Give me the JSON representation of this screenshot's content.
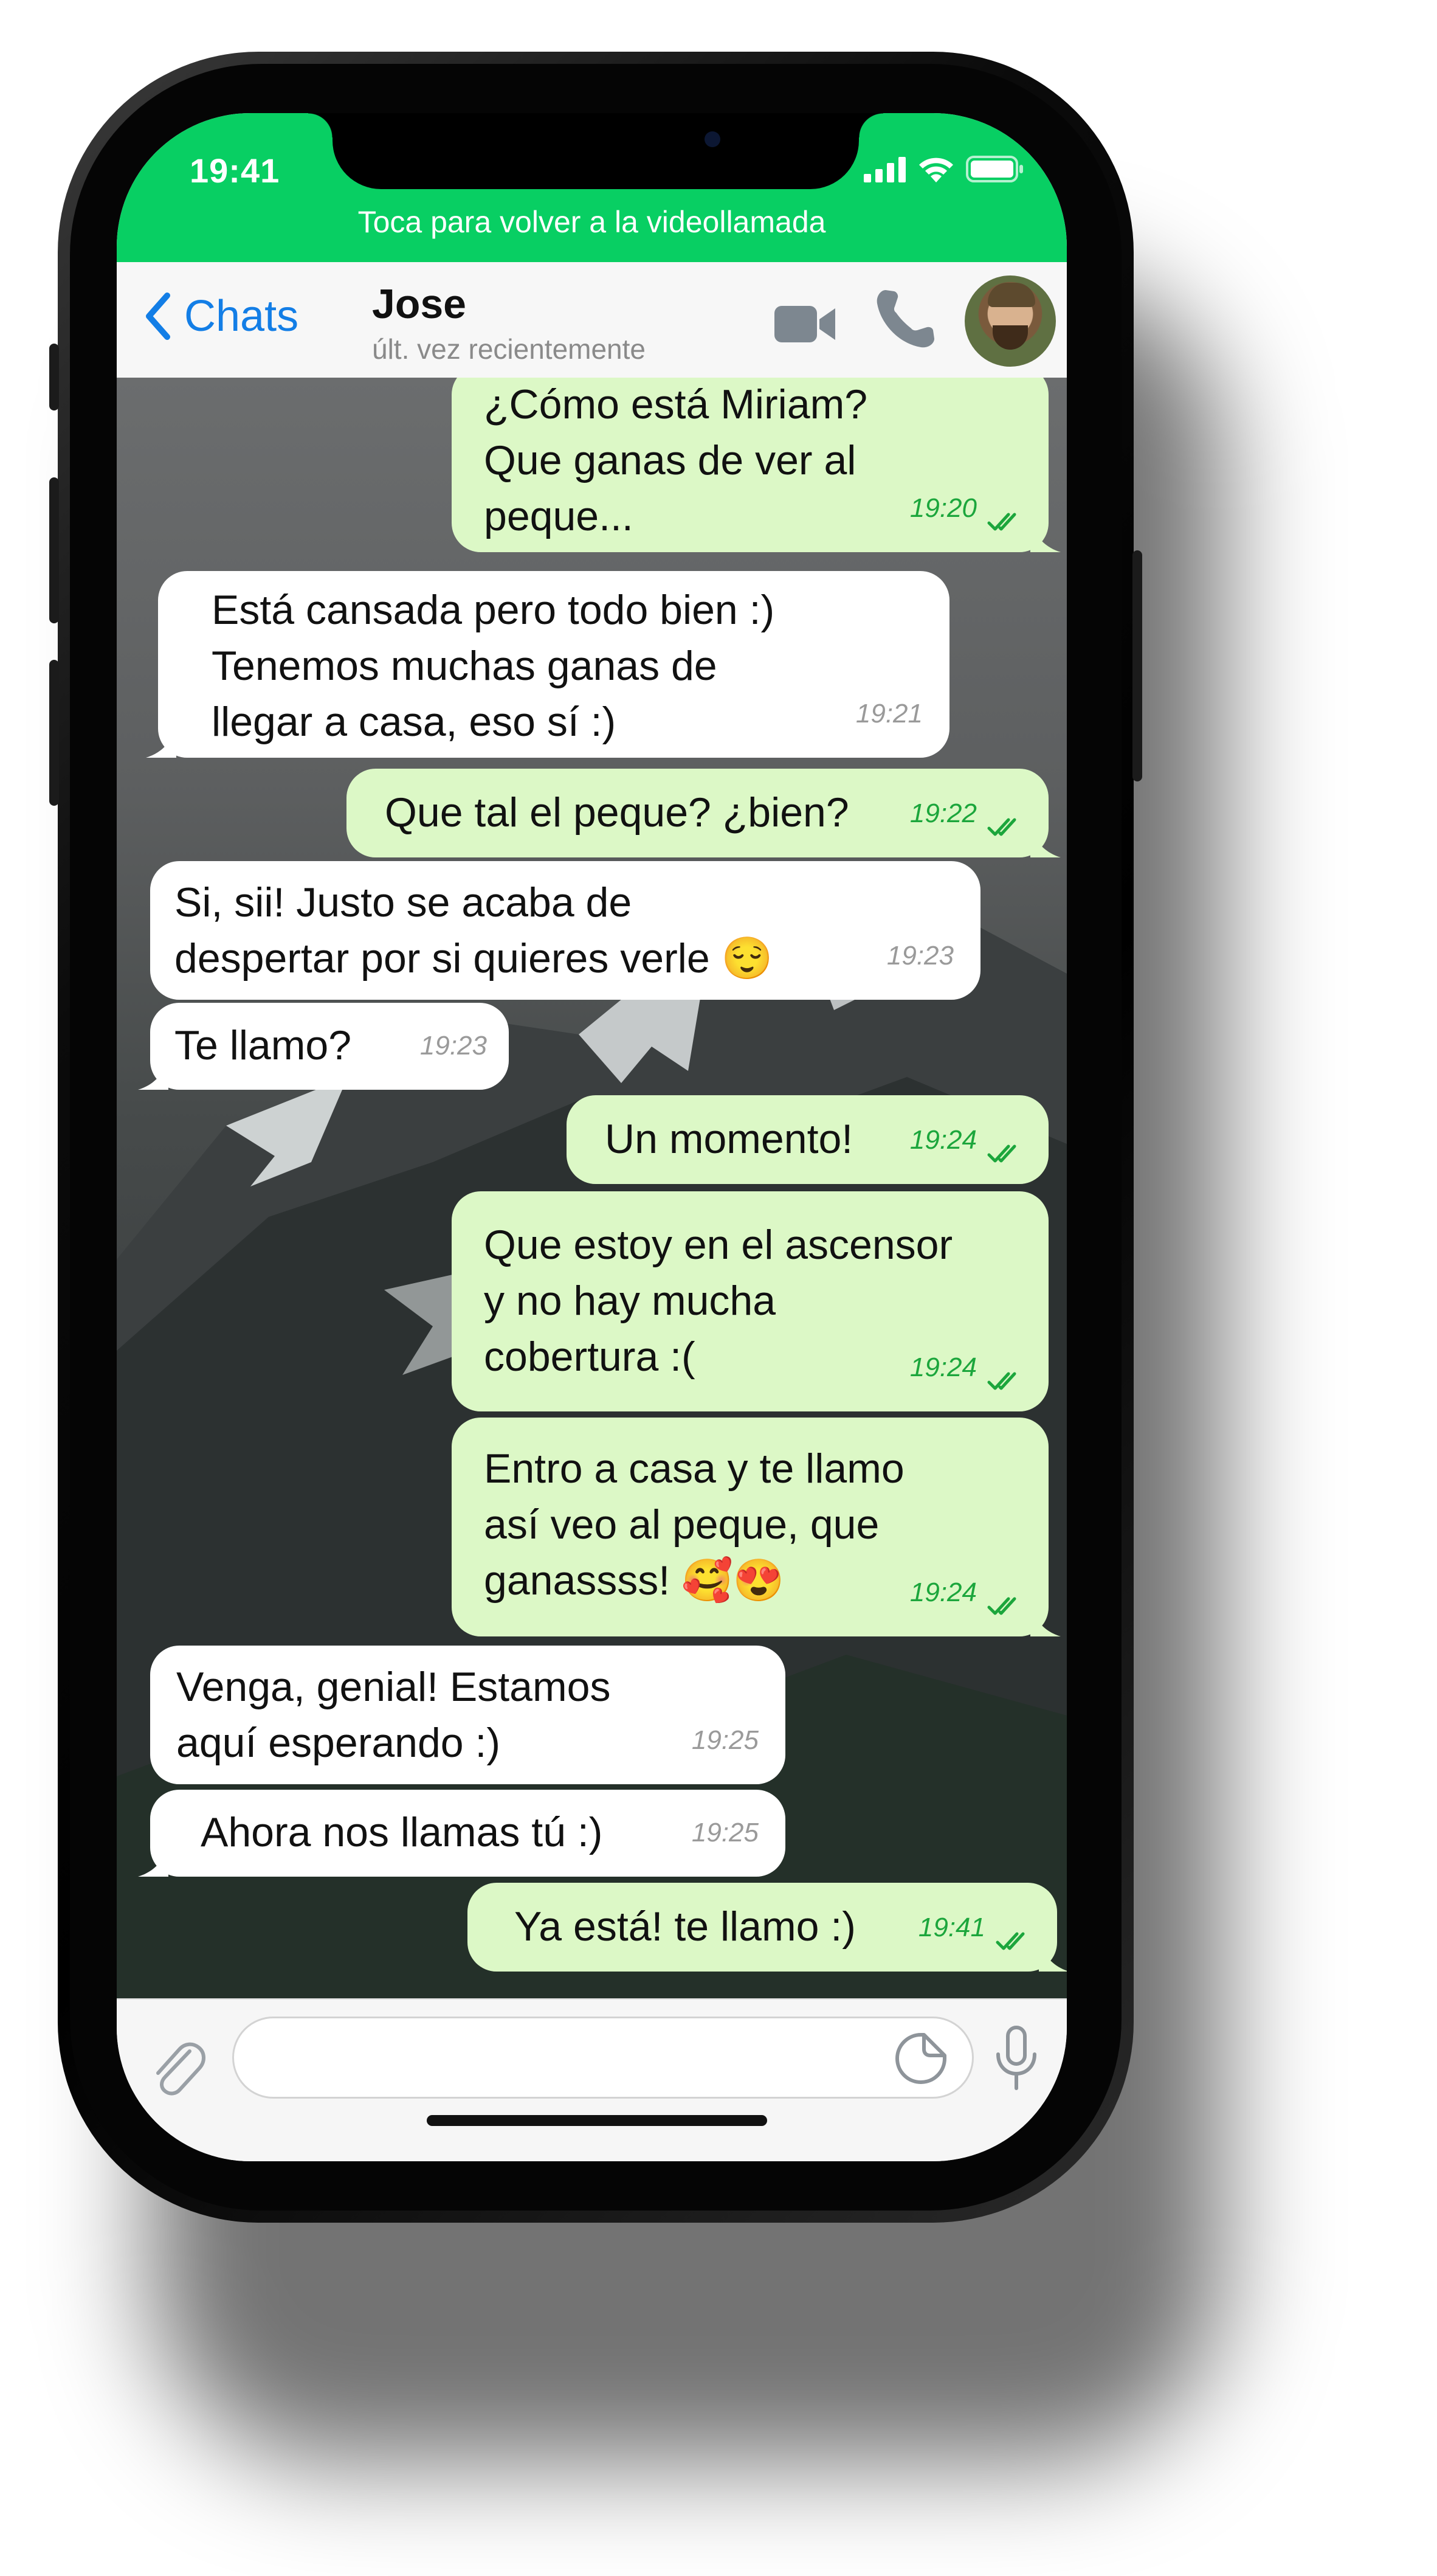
{
  "status_bar": {
    "time": "19:41"
  },
  "call_banner": {
    "text": "Toca para volver a la videollamada"
  },
  "nav": {
    "back_label": "Chats",
    "contact_name": "Jose",
    "contact_status": "últ. vez recientemente"
  },
  "messages": [
    {
      "dir": "out",
      "text": "¿Cómo está Miriam?\nQue ganas de ver al\npeque...",
      "time": "19:20",
      "read": true
    },
    {
      "dir": "in",
      "text": "Está cansada pero todo bien :)\nTenemos muchas ganas de\nllegar a casa, eso sí :)",
      "time": "19:21"
    },
    {
      "dir": "out",
      "text": "Que tal el peque? ¿bien?",
      "time": "19:22",
      "read": true
    },
    {
      "dir": "in",
      "text": "Si, sii! Justo se acaba de\ndespertar por si quieres verle 😌",
      "time": "19:23"
    },
    {
      "dir": "in",
      "text": "Te llamo?",
      "time": "19:23"
    },
    {
      "dir": "out",
      "text": "Un momento!",
      "time": "19:24",
      "read": true
    },
    {
      "dir": "out",
      "text": "Que estoy en el ascensor\ny no hay mucha\ncobertura :(",
      "time": "19:24",
      "read": true
    },
    {
      "dir": "out",
      "text": "Entro a casa y te llamo\nasí veo al peque, que\nganassss! 🥰😍",
      "time": "19:24",
      "read": true
    },
    {
      "dir": "in",
      "text": "Venga, genial! Estamos\naquí esperando :)",
      "time": "19:25"
    },
    {
      "dir": "in",
      "text": "Ahora nos llamas tú :)",
      "time": "19:25"
    },
    {
      "dir": "out",
      "text": "Ya está! te llamo :)",
      "time": "19:41",
      "read": true
    }
  ],
  "composer": {
    "placeholder": ""
  },
  "colors": {
    "banner_green": "#08cf63",
    "outgoing_bubble": "#dcf8c6",
    "incoming_bubble": "#ffffff",
    "link_blue": "#137ee6",
    "read_tick_green": "#1ca63c"
  },
  "icons": [
    "back-chevron-icon",
    "video-call-icon",
    "phone-call-icon",
    "attach-clip-icon",
    "sticker-icon",
    "microphone-icon",
    "signal-icon",
    "wifi-icon",
    "battery-icon",
    "double-check-icon"
  ]
}
